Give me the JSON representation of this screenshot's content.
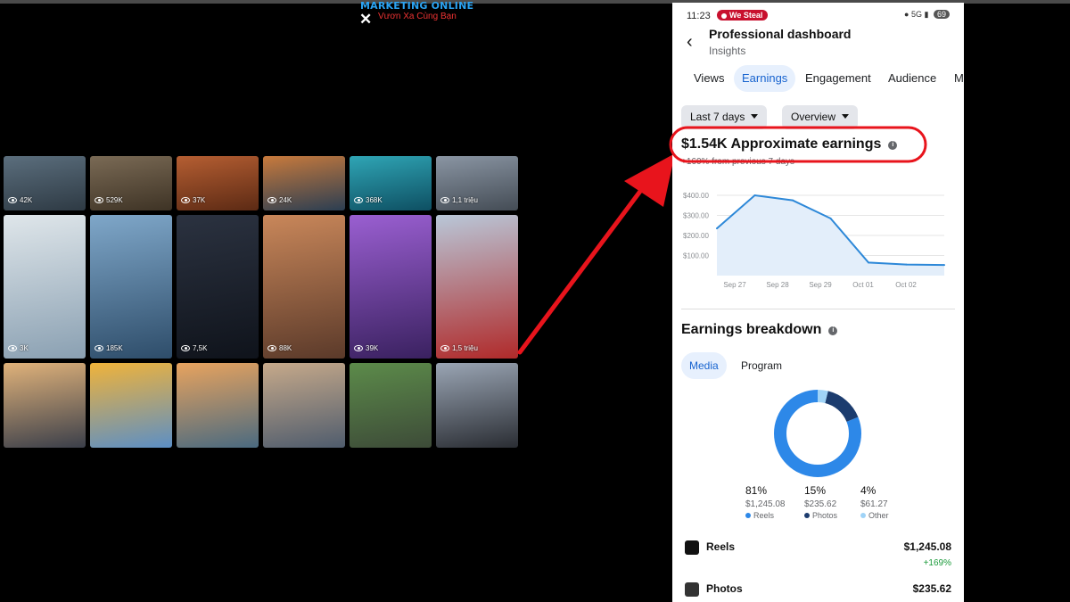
{
  "brand": {
    "line1": "MARKETING ONLINE",
    "line2": "Vươn Xa Cùng Bạn",
    "close": "✕"
  },
  "grid": {
    "watermark": "",
    "tiles": [
      {
        "views": "42K"
      },
      {
        "views": "529K"
      },
      {
        "views": "37K"
      },
      {
        "views": "24K"
      },
      {
        "views": "368K"
      },
      {
        "views": "1,1 triệu"
      },
      {
        "views": "3K"
      },
      {
        "views": "185K"
      },
      {
        "views": "7,5K"
      },
      {
        "views": "88K"
      },
      {
        "views": "39K"
      },
      {
        "views": "1,5 triệu"
      },
      {
        "views": ""
      },
      {
        "views": ""
      },
      {
        "views": ""
      },
      {
        "views": ""
      },
      {
        "views": ""
      },
      {
        "views": ""
      }
    ]
  },
  "status_bar": {
    "time": "11:23",
    "recording": "We Steal",
    "network": "5G",
    "battery": "69"
  },
  "header": {
    "title": "Professional dashboard",
    "subtitle": "Insights",
    "back_icon": "back-arrow-icon"
  },
  "tabs": [
    {
      "label": "Views"
    },
    {
      "label": "Earnings",
      "active": true
    },
    {
      "label": "Engagement"
    },
    {
      "label": "Audience"
    },
    {
      "label": "M"
    }
  ],
  "filters": {
    "range": "Last 7 days",
    "view": "Overview"
  },
  "earnings": {
    "headline": "$1.54K Approximate earnings",
    "change": "+160% from previous 7 days",
    "highlight_color": "#e8141c"
  },
  "chart_data": {
    "type": "area",
    "categories": [
      "Sep 27",
      "Sep 28",
      "Sep 29",
      "Oct 01",
      "Oct 02"
    ],
    "yticks": [
      "$400.00",
      "$300.00",
      "$200.00",
      "$100.00"
    ],
    "ylim": [
      0,
      400
    ],
    "series": [
      {
        "values": [
          235,
          400,
          375,
          285,
          65,
          55,
          53
        ]
      }
    ],
    "color": "#2d88d8",
    "fill": "#e3eefa"
  },
  "breakdown": {
    "title": "Earnings breakdown",
    "tabs": [
      {
        "label": "Media",
        "active": true
      },
      {
        "label": "Program"
      }
    ],
    "donut": [
      {
        "label": "Reels",
        "pct": "81%",
        "amount": "$1,245.08",
        "value": 81,
        "color": "#2d88e8"
      },
      {
        "label": "Photos",
        "pct": "15%",
        "amount": "$235.62",
        "value": 15,
        "color": "#1c3c6e"
      },
      {
        "label": "Other",
        "pct": "4%",
        "amount": "$61.27",
        "value": 4,
        "color": "#9fd3f7"
      }
    ],
    "rows": [
      {
        "name": "Reels",
        "value": "$1,245.08",
        "change": "+169%",
        "icon": "reels-icon"
      },
      {
        "name": "Photos",
        "value": "$235.62",
        "change": "",
        "icon": "photos-icon"
      }
    ]
  },
  "arrow_color": "#e8141c"
}
